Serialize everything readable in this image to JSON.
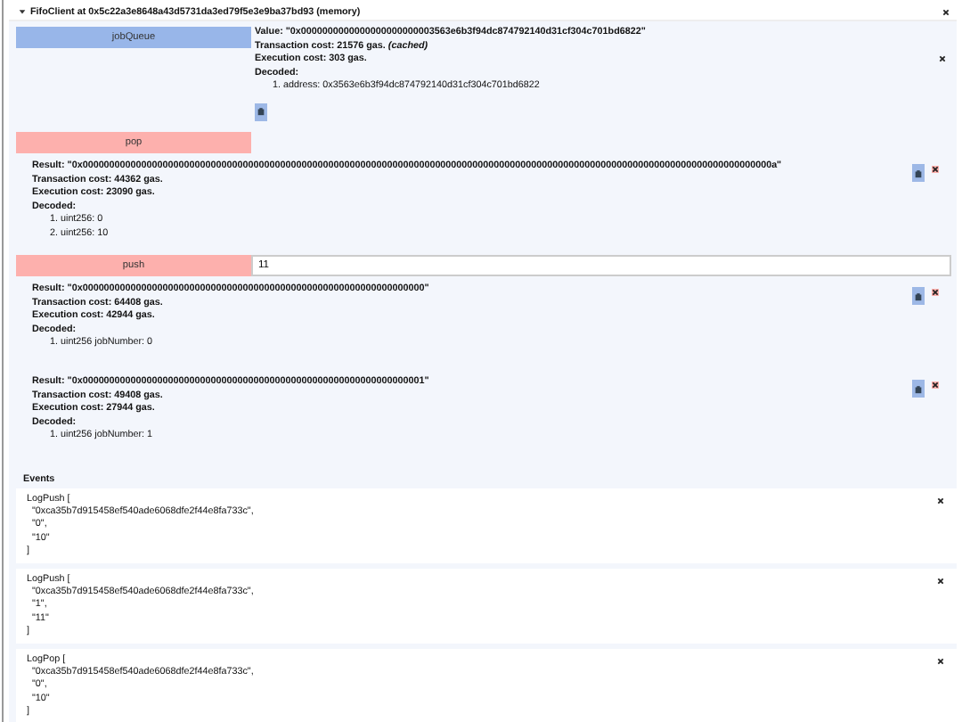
{
  "contract": {
    "title": "FifoClient at 0x5c22a3e8648a43d5731da3ed79f5e3e9ba37bd93 (memory)",
    "expanded": true
  },
  "functions": [
    {
      "label": "jobQueue",
      "kind": "call",
      "results": [
        {
          "result": "Value: \"0x0000000000000000000000003563e6b3f94dc874792140d31cf304c701bd6822\"",
          "transaction_cost": "Transaction cost: 21576 gas. *(cached)*",
          "execution_cost": "Execution cost: 303 gas.",
          "decoded_label": "Decoded:",
          "decoded": [
            "1. address: 0x3563e6b3f94dc874792140d31cf304c701bd6822"
          ]
        }
      ]
    },
    {
      "label": "pop",
      "kind": "transact",
      "results": [
        {
          "result": "Result: \"0x000000000000000000000000000000000000000000000000000000000000000000000000000000000000000000000000000000000000000000000000000000000a\"",
          "transaction_cost": "Transaction cost: 44362 gas.",
          "execution_cost": "Execution cost: 23090 gas.",
          "decoded_label": "Decoded:",
          "decoded": [
            "1. uint256: 0",
            "2. uint256: 10"
          ]
        }
      ]
    },
    {
      "label": "push",
      "kind": "transact",
      "input": "11",
      "results": [
        {
          "result": "Result: \"0x0000000000000000000000000000000000000000000000000000000000000000\"",
          "transaction_cost": "Transaction cost: 64408 gas.",
          "execution_cost": "Execution cost: 42944 gas.",
          "decoded_label": "Decoded:",
          "decoded": [
            "1. uint256 jobNumber: 0"
          ]
        },
        {
          "result": "Result: \"0x0000000000000000000000000000000000000000000000000000000000000001\"",
          "transaction_cost": "Transaction cost: 49408 gas.",
          "execution_cost": "Execution cost: 27944 gas.",
          "decoded_label": "Decoded:",
          "decoded": [
            "1. uint256 jobNumber: 1"
          ]
        }
      ]
    }
  ],
  "events_label": "Events",
  "events": [
    {
      "lines": [
        "LogPush [",
        "\"0xca35b7d915458ef540ade6068dfe2f44e8fa733c\",",
        "\"0\",",
        "\"10\"",
        "]"
      ]
    },
    {
      "lines": [
        "LogPush [",
        "\"0xca35b7d915458ef540ade6068dfe2f44e8fa733c\",",
        "\"1\",",
        "\"11\"",
        "]"
      ]
    },
    {
      "lines": [
        "LogPop [",
        "\"0xca35b7d915458ef540ade6068dfe2f44e8fa733c\",",
        "\"0\",",
        "\"10\"",
        "]"
      ]
    }
  ]
}
